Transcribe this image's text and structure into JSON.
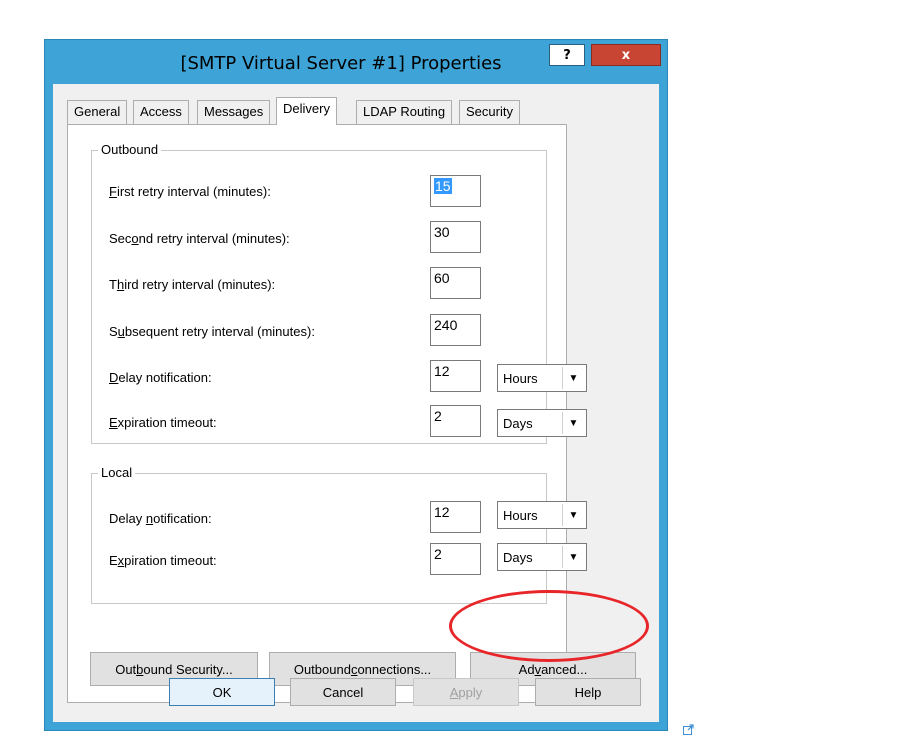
{
  "window": {
    "title": "[SMTP Virtual Server #1] Properties",
    "help_button": "?",
    "close_button": "x"
  },
  "tabs": [
    "General",
    "Access",
    "Messages",
    "Delivery",
    "LDAP Routing",
    "Security"
  ],
  "active_tab": "Delivery",
  "outbound": {
    "group_label": "Outbound",
    "first_retry": {
      "label_key": "F",
      "label_rest": "irst retry interval (minutes):",
      "value": "15"
    },
    "second_retry": {
      "label_pre": "Sec",
      "label_key": "o",
      "label_rest": "nd retry interval (minutes):",
      "value": "30"
    },
    "third_retry": {
      "label_pre": "T",
      "label_key": "h",
      "label_rest": "ird retry interval (minutes):",
      "value": "60"
    },
    "subsequent_retry": {
      "label_pre": "S",
      "label_key": "u",
      "label_rest": "bsequent retry interval (minutes):",
      "value": "240"
    },
    "delay_notification": {
      "label_key": "D",
      "label_rest": "elay notification:",
      "value": "12",
      "unit": "Hours"
    },
    "expiration_timeout": {
      "label_key": "E",
      "label_rest": "xpiration timeout:",
      "value": "2",
      "unit": "Days"
    }
  },
  "local": {
    "group_label": "Local",
    "delay_notification": {
      "label_pre": "Delay ",
      "label_key": "n",
      "label_rest": "otification:",
      "value": "12",
      "unit": "Hours"
    },
    "expiration_timeout": {
      "label_pre": "E",
      "label_key": "x",
      "label_rest": "piration timeout:",
      "value": "2",
      "unit": "Days"
    }
  },
  "panel_buttons": {
    "outbound_security": {
      "pre": "Out",
      "key": "b",
      "rest": "ound Security..."
    },
    "outbound_connections": {
      "pre": "Outbound ",
      "key": "c",
      "rest": "onnections..."
    },
    "advanced": {
      "pre": "Ad",
      "key": "v",
      "rest": "anced..."
    }
  },
  "dialog_buttons": {
    "ok": "OK",
    "cancel": "Cancel",
    "apply": {
      "key": "A",
      "rest": "pply"
    },
    "help": "Help"
  },
  "colors": {
    "title_bar": "#3ea3d6",
    "close_button": "#c84433",
    "selection": "#3399ff",
    "annotation": "#e8262a"
  },
  "icons": {
    "combo_arrow": "chevron-down-icon",
    "external_link": "external-link-icon"
  }
}
